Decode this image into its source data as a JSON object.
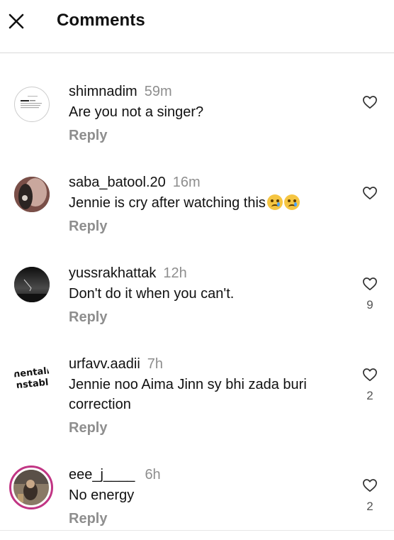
{
  "header": {
    "title": "Comments"
  },
  "comments": [
    {
      "username": "shimnadim",
      "time": "59m",
      "text": "Are you not a singer?",
      "reply": "Reply",
      "likes": ""
    },
    {
      "username": "saba_batool.20",
      "time": "16m",
      "text": "Jennie is cry after watching this",
      "reply": "Reply",
      "likes": ""
    },
    {
      "username": "yussrakhattak",
      "time": "12h",
      "text": "Don't do it when you can't.",
      "reply": "Reply",
      "likes": "9"
    },
    {
      "username": "urfavv.aadii",
      "time": "7h",
      "text": "Jennie noo Aima Jinn sy bhi zada buri correction",
      "reply": "Reply",
      "likes": "2"
    },
    {
      "username": "eee_j____",
      "time": "6h",
      "text": "No energy",
      "reply": "Reply",
      "likes": "2"
    }
  ],
  "icons": {
    "close": "close-icon",
    "like": "heart-outline-icon",
    "emoji": "crying-face-emoji"
  },
  "colors": {
    "text": "#111111",
    "muted": "#8e8e8e",
    "divider": "#d9d9d9"
  }
}
